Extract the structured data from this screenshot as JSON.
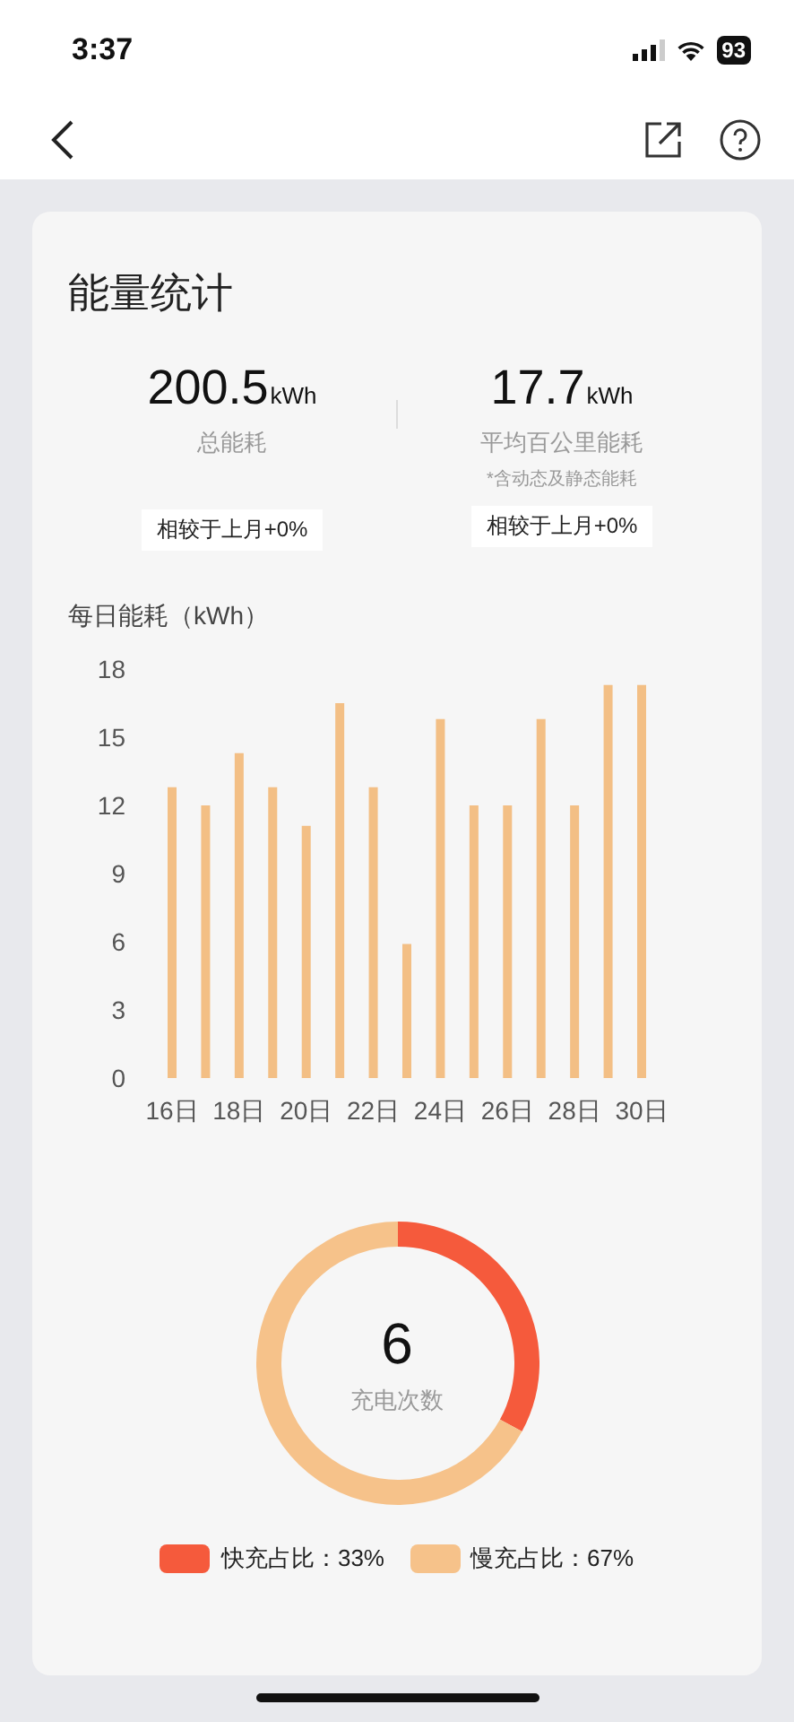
{
  "status_bar": {
    "time": "3:37",
    "battery": "93"
  },
  "card": {
    "title": "能量统计",
    "stats": [
      {
        "value": "200.5",
        "unit": "kWh",
        "label": "总能耗",
        "compare": "相较于上月+0%"
      },
      {
        "value": "17.7",
        "unit": "kWh",
        "label": "平均百公里能耗",
        "note": "*含动态及静态能耗",
        "compare": "相较于上月+0%"
      }
    ],
    "daily_chart": {
      "title": "每日能耗（kWh）",
      "chart_data": {
        "type": "bar",
        "x": [
          16,
          17,
          18,
          19,
          20,
          21,
          22,
          23,
          24,
          25,
          26,
          27,
          28,
          29,
          30
        ],
        "values": [
          12.8,
          12.0,
          14.3,
          12.8,
          11.1,
          16.5,
          12.8,
          5.9,
          15.8,
          12.0,
          12.0,
          15.8,
          12.0,
          17.3,
          17.3
        ],
        "xlim": [
          16,
          30
        ],
        "ylim": [
          0,
          18
        ],
        "yticks": [
          0,
          3,
          6,
          9,
          12,
          15,
          18
        ],
        "xticks": [
          {
            "value": 16,
            "label": "16日"
          },
          {
            "value": 18,
            "label": "18日"
          },
          {
            "value": 20,
            "label": "20日"
          },
          {
            "value": 22,
            "label": "22日"
          },
          {
            "value": 24,
            "label": "24日"
          },
          {
            "value": 26,
            "label": "26日"
          },
          {
            "value": 28,
            "label": "28日"
          },
          {
            "value": 30,
            "label": "30日"
          }
        ]
      }
    },
    "charging": {
      "count": "6",
      "count_label": "充电次数",
      "chart_data": {
        "type": "donut",
        "values": [
          33,
          67
        ]
      },
      "legend": [
        {
          "label": "快充占比：33%",
          "color": "#f55a3c"
        },
        {
          "label": "慢充占比：67%",
          "color": "#f6c28a"
        }
      ]
    }
  }
}
